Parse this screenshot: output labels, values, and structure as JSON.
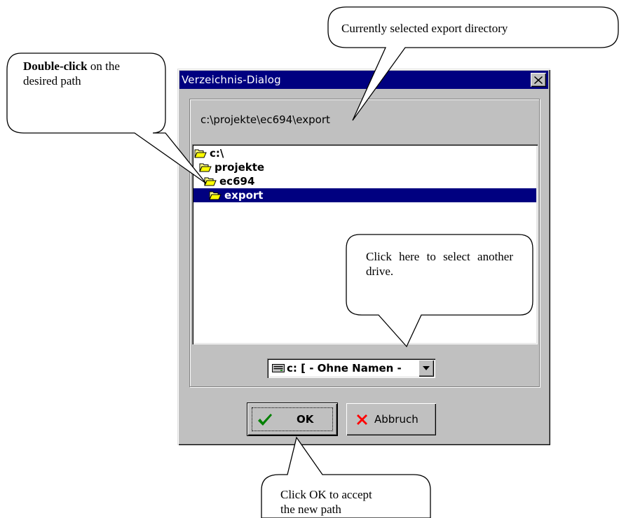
{
  "dialog": {
    "title": "Verzeichnis-Dialog",
    "current_path": "c:\\projekte\\ec694\\export",
    "tree": [
      {
        "label": "c:\\",
        "icon": "open-folder-icon",
        "selected": false
      },
      {
        "label": "projekte",
        "icon": "open-folder-icon",
        "selected": false
      },
      {
        "label": "ec694",
        "icon": "open-folder-icon",
        "selected": false
      },
      {
        "label": "export",
        "icon": "open-folder-icon",
        "selected": true
      }
    ],
    "drive": {
      "value": "c: [ - Ohne Namen -",
      "icon": "drive-icon"
    },
    "ok_label": "OK",
    "cancel_label": "Abbruch",
    "colors": {
      "titlebar": "#000080",
      "face": "#c0c0c0",
      "selection": "#000080",
      "ok_check": "#008000",
      "cancel_x": "#ff0000"
    }
  },
  "callouts": {
    "export_dir": "Currently selected export directory",
    "double_click_bold": "Double-click",
    "double_click_rest": " on the desired path",
    "drive": "Click here to select another drive.",
    "ok": "Click OK to accept the new path"
  }
}
